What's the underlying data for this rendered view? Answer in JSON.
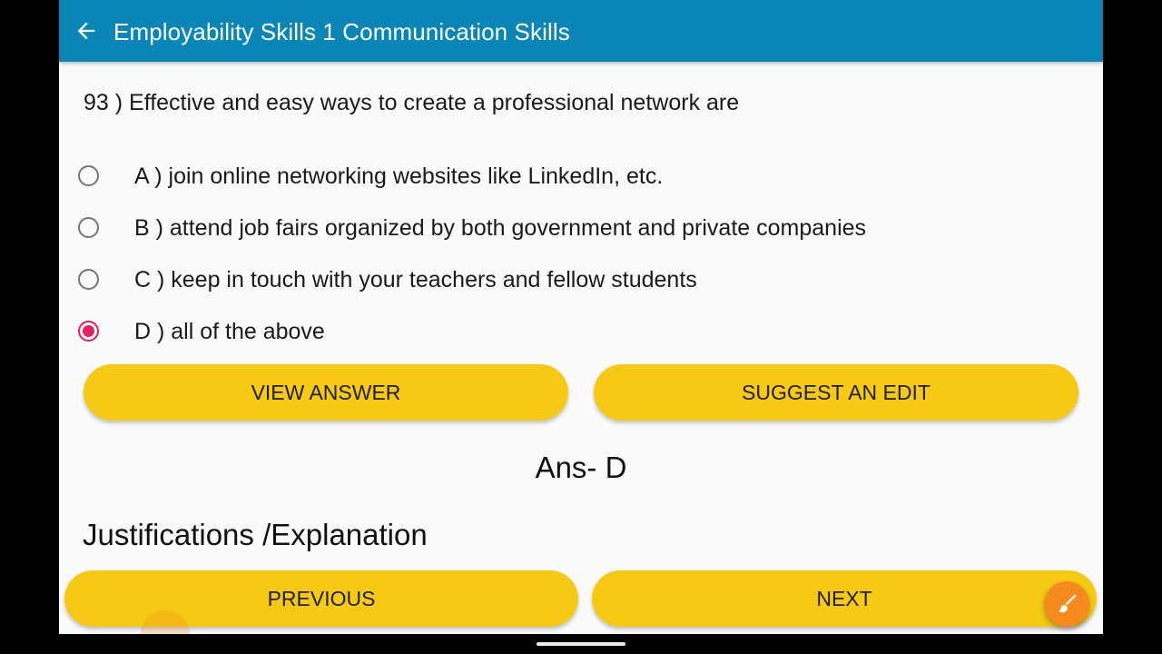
{
  "appbar": {
    "title": "Employability Skills 1 Communication Skills",
    "back_icon": "arrow-left-icon",
    "background": "#0a86b6"
  },
  "question": {
    "text": "93 ) Effective and easy ways to create a professional network are",
    "options": [
      {
        "label": "A ) join online networking websites like LinkedIn, etc.",
        "selected": false
      },
      {
        "label": "B ) attend job fairs organized by both government and private companies",
        "selected": false
      },
      {
        "label": "C ) keep in touch with your teachers and fellow students",
        "selected": false
      },
      {
        "label": "D ) all of the above",
        "selected": true
      }
    ]
  },
  "actions": {
    "view_answer": "VIEW ANSWER",
    "suggest_edit": "SUGGEST AN EDIT"
  },
  "answer": {
    "text": "Ans- D"
  },
  "explanation": {
    "heading": "Justifications /Explanation"
  },
  "navigation": {
    "previous": "PREVIOUS",
    "next": "NEXT"
  },
  "fab": {
    "icon": "paint-brush-icon"
  },
  "colors": {
    "button": "#f6c915",
    "radio_selected": "#e0245e",
    "fab": "#f58a1f"
  }
}
